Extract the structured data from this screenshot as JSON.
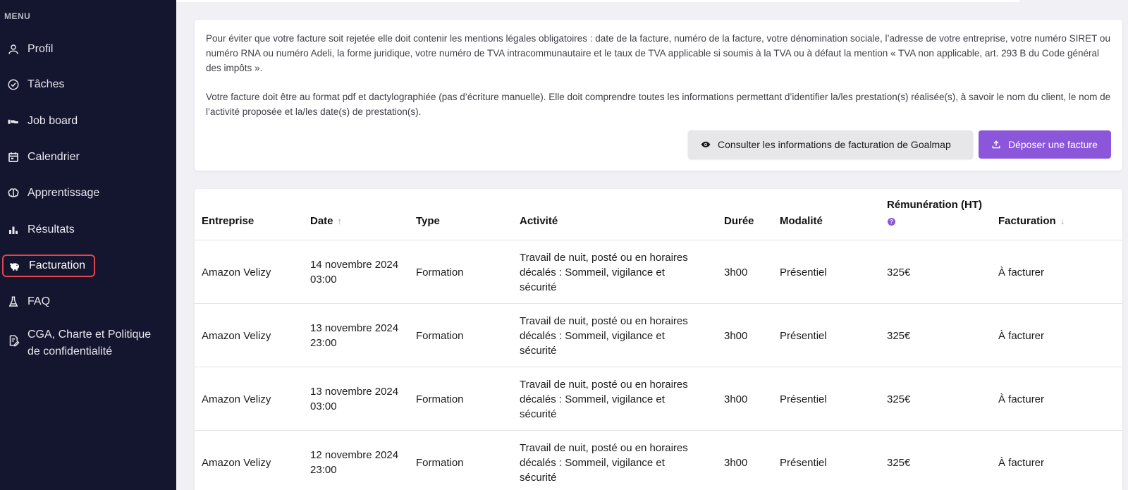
{
  "sidebar": {
    "menu_label": "MENU",
    "items": [
      {
        "label": "Profil",
        "icon": "user-icon"
      },
      {
        "label": "Tâches",
        "icon": "check-circle-icon"
      },
      {
        "label": "Job board",
        "icon": "handshake-icon"
      },
      {
        "label": "Calendrier",
        "icon": "calendar-icon"
      },
      {
        "label": "Apprentissage",
        "icon": "brain-icon"
      },
      {
        "label": "Résultats",
        "icon": "bar-chart-icon"
      },
      {
        "label": "Facturation",
        "icon": "piggy-bank-icon",
        "active": true
      },
      {
        "label": "FAQ",
        "icon": "flask-icon"
      },
      {
        "label_line1": "CGA, Charte et Politique",
        "label_line2": "de confidentialité",
        "icon": "document-edit-icon"
      }
    ]
  },
  "info": {
    "paragraph1": "Pour éviter que votre facture soit rejetée elle doit contenir les mentions légales obligatoires : date de la facture, numéro de la facture, votre dénomination sociale, l’adresse de votre entreprise, votre numéro SIRET ou numéro RNA ou numéro Adeli, la forme juridique, votre numéro de TVA intracommunautaire et le taux de TVA applicable si soumis à la TVA ou à défaut la mention « TVA non applicable, art. 293 B du Code général des impôts ».",
    "paragraph2": "Votre facture doit être au format pdf et dactylographiée (pas d’écriture manuelle). Elle doit comprendre toutes les informations permettant d’identifier la/les prestation(s) réalisée(s), à savoir le nom du client, le nom de l’activité proposée et la/les date(s) de prestation(s).",
    "consult_button": "Consulter les informations de facturation de Goalmap",
    "upload_button": "Déposer une facture"
  },
  "table": {
    "headers": {
      "entreprise": "Entreprise",
      "date": "Date",
      "type": "Type",
      "activite": "Activité",
      "duree": "Durée",
      "modalite": "Modalité",
      "remuneration": "Rémunération (HT)",
      "facturation": "Facturation"
    },
    "rows": [
      {
        "entreprise": "Amazon Velizy",
        "date1": "14 novembre 2024",
        "date2": "03:00",
        "type": "Formation",
        "act1": "Travail de nuit, posté ou en horaires",
        "act2": "décalés : Sommeil, vigilance et",
        "act3": "sécurité",
        "duree": "3h00",
        "modalite": "Présentiel",
        "remuneration": "325€",
        "facturation": "À facturer"
      },
      {
        "entreprise": "Amazon Velizy",
        "date1": "13 novembre 2024",
        "date2": "23:00",
        "type": "Formation",
        "act1": "Travail de nuit, posté ou en horaires",
        "act2": "décalés : Sommeil, vigilance et",
        "act3": "sécurité",
        "duree": "3h00",
        "modalite": "Présentiel",
        "remuneration": "325€",
        "facturation": "À facturer"
      },
      {
        "entreprise": "Amazon Velizy",
        "date1": "13 novembre 2024",
        "date2": "03:00",
        "type": "Formation",
        "act1": "Travail de nuit, posté ou en horaires",
        "act2": "décalés : Sommeil, vigilance et",
        "act3": "sécurité",
        "duree": "3h00",
        "modalite": "Présentiel",
        "remuneration": "325€",
        "facturation": "À facturer"
      },
      {
        "entreprise": "Amazon Velizy",
        "date1": "12 novembre 2024",
        "date2": "23:00",
        "type": "Formation",
        "act1": "Travail de nuit, posté ou en horaires",
        "act2": "décalés : Sommeil, vigilance et",
        "act3": "sécurité",
        "duree": "3h00",
        "modalite": "Présentiel",
        "remuneration": "325€",
        "facturation": "À facturer"
      }
    ]
  },
  "colors": {
    "sidebar_bg": "#14152e",
    "accent_purple": "#8b56d9",
    "active_border": "#e2454e"
  }
}
